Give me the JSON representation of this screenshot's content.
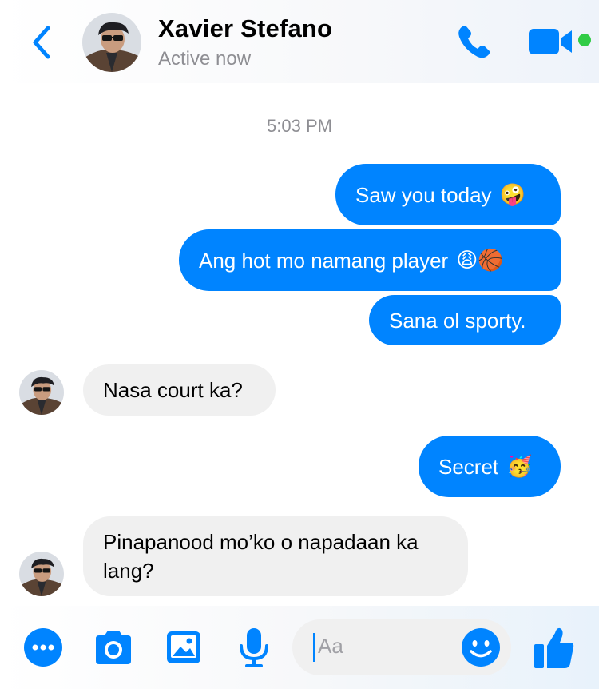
{
  "header": {
    "contact_name": "Xavier Stefano",
    "status": "Active now",
    "back_icon": "chevron-left-icon",
    "call_icon": "phone-icon",
    "video_icon": "video-camera-icon",
    "online_color": "#31cc46"
  },
  "conversation": {
    "timestamp": "5:03 PM",
    "messages": [
      {
        "sender": "me",
        "text": "Saw you today",
        "emoji": "🤪"
      },
      {
        "sender": "me",
        "text": "Ang hot mo namang player",
        "emoji": "😩🏀"
      },
      {
        "sender": "me",
        "text": "Sana ol sporty.",
        "emoji": ""
      },
      {
        "sender": "Xavier Stefano",
        "text": "Nasa court ka?",
        "emoji": ""
      },
      {
        "sender": "me",
        "text": "Secret",
        "emoji": "🥳"
      },
      {
        "sender": "Xavier Stefano",
        "text": "Pinapanood mo’ko o napadaan ka lang?",
        "emoji": ""
      }
    ]
  },
  "composer": {
    "placeholder": "Aa",
    "icons": [
      "more-icon",
      "camera-icon",
      "gallery-icon",
      "microphone-icon",
      "emoji-icon",
      "thumbs-up-icon"
    ]
  },
  "colors": {
    "accent": "#0084ff",
    "incoming_bubble": "#f0f0f0",
    "secondary_text": "#8e8e93"
  }
}
